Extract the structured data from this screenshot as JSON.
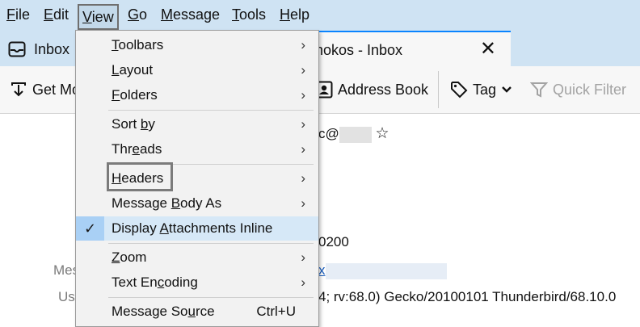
{
  "menubar": {
    "file": "File",
    "edit": "Edit",
    "view": "View",
    "go": "Go",
    "message": "Message",
    "tools": "Tools",
    "help": "Help"
  },
  "tabs": {
    "inbox_label": "Inbox",
    "active_title": "nokos - Inbox",
    "close_glyph": "✕"
  },
  "toolbar": {
    "get_messages": "Get Mo",
    "address_book": "Address Book",
    "tag": "Tag",
    "quick_filter": "Quick Filter"
  },
  "content": {
    "from_partial": "c@",
    "date_partial": "0200",
    "mes_label": "Mes",
    "link_partial": "x",
    "us_label": "Us",
    "user_agent_partial": "4; rv:68.0) Gecko/20100101 Thunderbird/68.10.0"
  },
  "view_menu": {
    "items": [
      {
        "label": "Toolbars",
        "mnemonic": "T",
        "rest": "oolbars",
        "submenu": true
      },
      {
        "label": "Layout",
        "mnemonic": "L",
        "rest": "ayout",
        "submenu": true
      },
      {
        "label": "Folders",
        "mnemonic": "F",
        "rest": "olders",
        "submenu": true
      },
      {
        "label": "Sort by",
        "pre": "Sort ",
        "mnemonic": "b",
        "rest": "y",
        "submenu": true
      },
      {
        "label": "Threads",
        "pre": "Thr",
        "mnemonic": "e",
        "rest": "ads",
        "submenu": true
      },
      {
        "label": "Headers",
        "mnemonic": "H",
        "rest": "eaders",
        "submenu": true
      },
      {
        "label": "Message Body As",
        "pre": "Message ",
        "mnemonic": "B",
        "rest": "ody As",
        "submenu": true
      },
      {
        "label": "Display Attachments Inline",
        "pre": "Display ",
        "mnemonic": "A",
        "rest": "ttachments Inline",
        "checked": true
      },
      {
        "label": "Zoom",
        "mnemonic": "Z",
        "rest": "oom",
        "submenu": true
      },
      {
        "label": "Text Encoding",
        "pre": "Text En",
        "mnemonic": "c",
        "rest": "oding",
        "submenu": true
      },
      {
        "label": "Message Source",
        "pre": "Message So",
        "mnemonic": "u",
        "rest": "rce",
        "shortcut": "Ctrl+U"
      }
    ],
    "arrow": "›",
    "check": "✓"
  }
}
